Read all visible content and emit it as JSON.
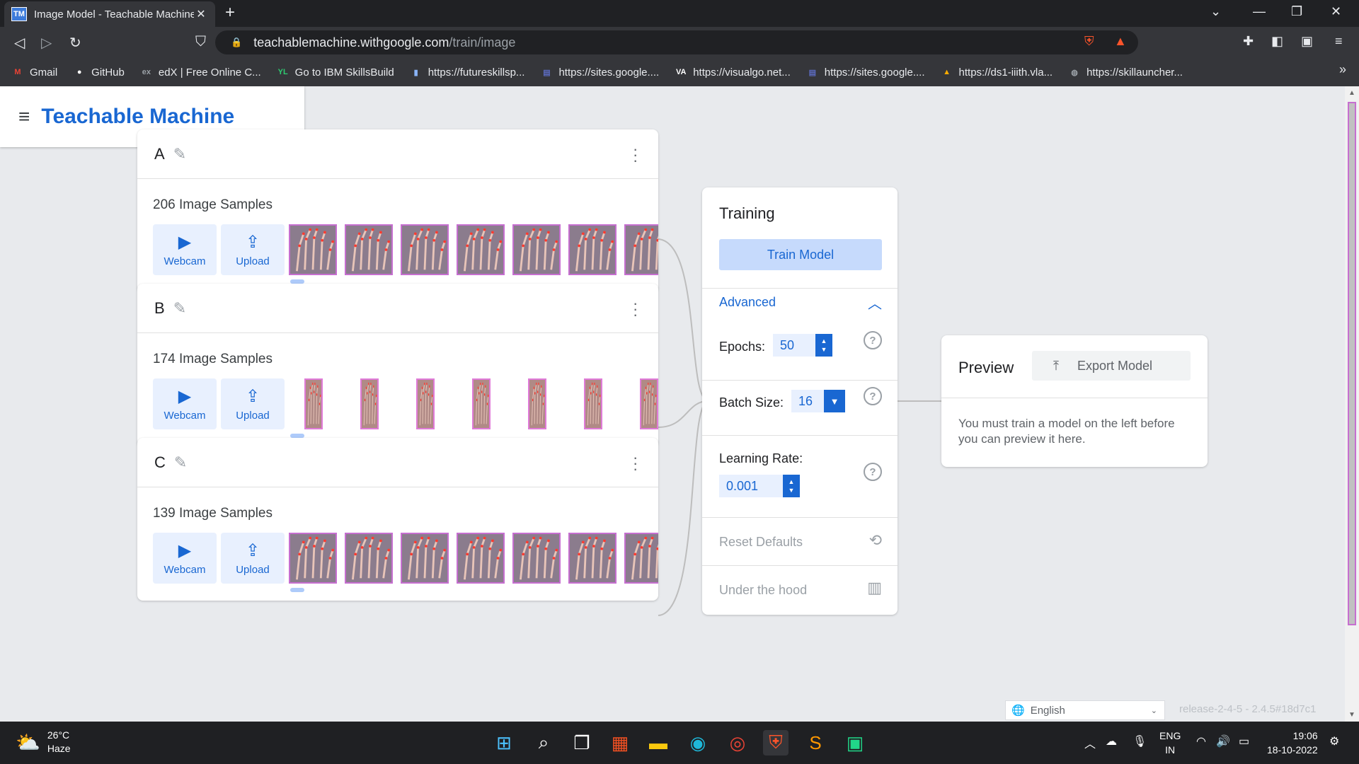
{
  "browser": {
    "tab_title": "Image Model - Teachable Machine",
    "tab_favicon": "TM",
    "url_host": "teachablemachine.withgoogle.com",
    "url_path": "/train/image",
    "bookmarks": [
      {
        "label": "Gmail",
        "icon": "gmail-icon",
        "color": "#ea4335",
        "glyph": "M"
      },
      {
        "label": "GitHub",
        "icon": "github-icon",
        "color": "#ffffff",
        "glyph": "●"
      },
      {
        "label": "edX | Free Online C...",
        "icon": "edx-icon",
        "color": "#9aa0a6",
        "glyph": "ex"
      },
      {
        "label": "Go to IBM SkillsBuild",
        "icon": "ibm-icon",
        "color": "#2ecc71",
        "glyph": "YL"
      },
      {
        "label": "https://futureskillsp...",
        "icon": "futureskills-icon",
        "color": "#8ab4f8",
        "glyph": "▮"
      },
      {
        "label": "https://sites.google....",
        "icon": "google-sites-icon",
        "color": "#5c6bc0",
        "glyph": "▤"
      },
      {
        "label": "https://visualgo.net...",
        "icon": "visualgo-icon",
        "color": "#ffffff",
        "glyph": "VA"
      },
      {
        "label": "https://sites.google....",
        "icon": "google-sites-icon",
        "color": "#5c6bc0",
        "glyph": "▤"
      },
      {
        "label": "https://ds1-iiith.vla...",
        "icon": "vlab-icon",
        "color": "#f9ab00",
        "glyph": "▲"
      },
      {
        "label": "https://skillauncher...",
        "icon": "globe-icon",
        "color": "#9aa0a6",
        "glyph": "◍"
      }
    ]
  },
  "app": {
    "brand": "Teachable Machine"
  },
  "classes": [
    {
      "name": "A",
      "samples": "206 Image Samples",
      "webcam": "Webcam",
      "upload": "Upload",
      "thumb_style": "square"
    },
    {
      "name": "B",
      "samples": "174 Image Samples",
      "webcam": "Webcam",
      "upload": "Upload",
      "thumb_style": "narrow"
    },
    {
      "name": "C",
      "samples": "139 Image Samples",
      "webcam": "Webcam",
      "upload": "Upload",
      "thumb_style": "square"
    }
  ],
  "training": {
    "title": "Training",
    "train_button": "Train Model",
    "advanced": "Advanced",
    "epochs_label": "Epochs:",
    "epochs_value": "50",
    "batch_label": "Batch Size:",
    "batch_value": "16",
    "lr_label": "Learning Rate:",
    "lr_value": "0.001",
    "reset": "Reset Defaults",
    "under_hood": "Under the hood",
    "help_glyph": "?"
  },
  "preview": {
    "title": "Preview",
    "export_button": "Export Model",
    "message": "You must train a model on the left before you can preview it here."
  },
  "footer": {
    "language": "English",
    "release": "release-2-4-5 - 2.4.5#18d7c1"
  },
  "taskbar": {
    "temperature": "26°C",
    "weather": "Haze",
    "lang_top": "ENG",
    "lang_bottom": "IN",
    "time": "19:06",
    "date": "18-10-2022"
  },
  "colors": {
    "accent": "#1967d2",
    "accent_light": "#e8f0fe",
    "thumb_border": "#c66fd0"
  }
}
